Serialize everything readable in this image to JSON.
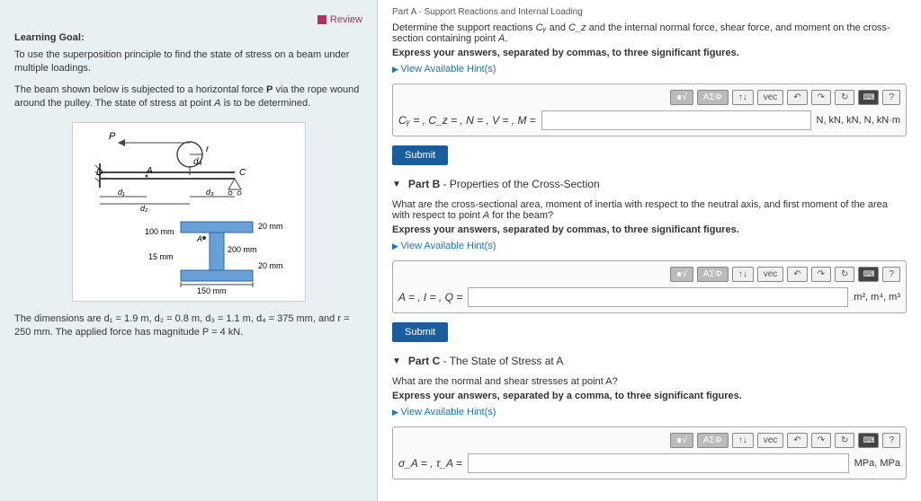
{
  "left": {
    "review": "Review",
    "learning_goal_label": "Learning Goal:",
    "learning_goal_text": "To use the superposition principle to find the state of stress on a beam under multiple loadings.",
    "beam_text_1": "The beam shown below is subjected to a horizontal force ",
    "beam_text_p": "P",
    "beam_text_2": " via the rope wound around the pulley. The state of stress at point ",
    "beam_text_a": "A",
    "beam_text_3": " is to be determined.",
    "diagram_labels": {
      "P": "P",
      "r": "r",
      "d4": "d₄",
      "A": "A",
      "C": "C",
      "D": "D",
      "d1": "d₁",
      "d2": "d₂",
      "d3": "d₃",
      "val20": "20 mm",
      "val100": "100 mm",
      "val200": "200 mm",
      "val15": "15 mm",
      "val150": "150 mm"
    },
    "dim_text": "The dimensions are d₁ = 1.9 m, d₂ = 0.8 m, d₃ = 1.1 m, d₄ = 375 mm, and r = 250 mm. The applied force has magnitude P = 4 kN."
  },
  "right": {
    "top_strip": "Part A · Support Reactions and Internal Loading",
    "partA": {
      "instruction_1": "Determine the support reactions ",
      "cy": "Cᵧ",
      "and1": " and ",
      "cz": "C_z",
      "instruction_2": " and the internal normal force, shear force, and moment on the cross-section containing point ",
      "pointA": "A",
      "period": ".",
      "express": "Express your answers, separated by commas, to three significant figures.",
      "hint": "View Available Hint(s)",
      "prefix": "Cᵧ = , C_z = , N = , V = , M =",
      "units": "N, kN, kN, N, kN·m",
      "submit": "Submit"
    },
    "partB": {
      "title_bold": "Part B",
      "title_rest": " - Properties of the Cross-Section",
      "instruction_1": "What are the cross-sectional area, moment of inertia with respect to the neutral axis, and first moment of the area with respect to point ",
      "pointA": "A",
      "instruction_2": " for the beam?",
      "express": "Express your answers, separated by commas, to three significant figures.",
      "hint": "View Available Hint(s)",
      "prefix": "A = , I = , Q =",
      "units": "m², m⁴, m³",
      "submit": "Submit"
    },
    "partC": {
      "title_bold": "Part C",
      "title_rest": " - The State of Stress at A",
      "instruction": "What are the normal and shear stresses at point A?",
      "express": "Express your answers, separated by a comma, to three significant figures.",
      "hint": "View Available Hint(s)",
      "prefix": "σ_A = , τ_A =",
      "units": "MPa, MPa"
    },
    "toolbar": {
      "sqrt": "∎√",
      "ggreek": "ΑΣΦ",
      "arrows": "↑↓",
      "vec": "vec",
      "undo": "↶",
      "redo": "↷",
      "reset": "↻",
      "kbd": "⌨",
      "help": "?"
    }
  }
}
